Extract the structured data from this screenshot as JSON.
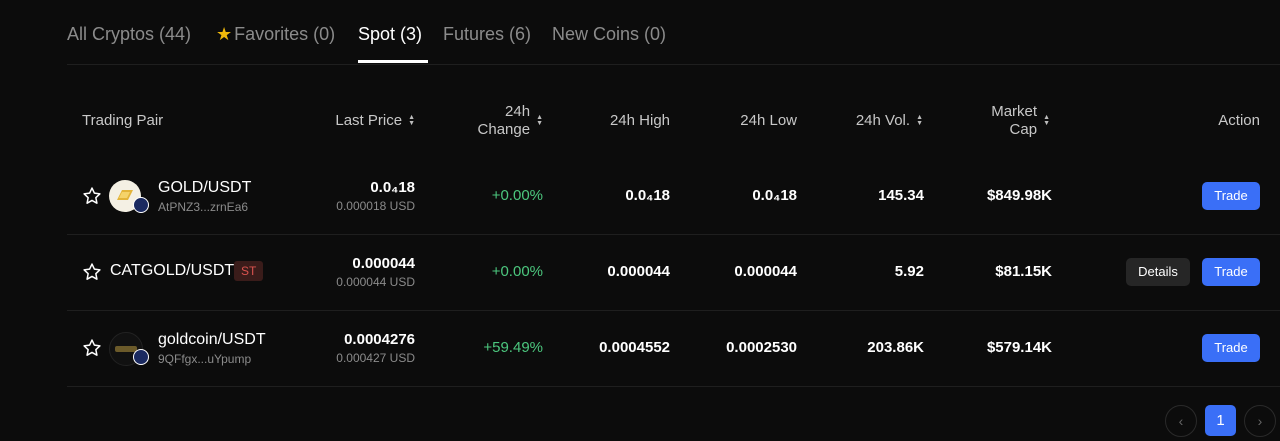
{
  "tabs": [
    {
      "label": "All Cryptos (44)"
    },
    {
      "label": "Favorites (0)"
    },
    {
      "label": "Spot (3)"
    },
    {
      "label": "Futures (6)"
    },
    {
      "label": "New Coins (0)"
    }
  ],
  "headers": {
    "pair": "Trading Pair",
    "last_price": "Last Price",
    "change_1": "24h",
    "change_2": "Change",
    "high": "24h High",
    "low": "24h Low",
    "vol": "24h Vol.",
    "cap_1": "Market",
    "cap_2": "Cap",
    "action": "Action"
  },
  "rows": [
    {
      "pair": "GOLD/USDT",
      "address": "AtPNZ3...zrnEa6",
      "price_main": "0.0₄18",
      "price_usd": "0.000018 USD",
      "change": "+0.00%",
      "high": "0.0₄18",
      "low": "0.0₄18",
      "vol": "145.34",
      "cap": "$849.98K",
      "trade": "Trade"
    },
    {
      "pair": "CATGOLD/USDT",
      "badge": "ST",
      "price_main": "0.000044",
      "price_usd": "0.000044 USD",
      "change": "+0.00%",
      "high": "0.000044",
      "low": "0.000044",
      "vol": "5.92",
      "cap": "$81.15K",
      "details": "Details",
      "trade": "Trade"
    },
    {
      "pair": "goldcoin/USDT",
      "address": "9QFfgx...uYpump",
      "price_main": "0.0004276",
      "price_usd": "0.000427 USD",
      "change": "+59.49%",
      "high": "0.0004552",
      "low": "0.0002530",
      "vol": "203.86K",
      "cap": "$579.14K",
      "trade": "Trade"
    }
  ],
  "pagination": {
    "current": "1"
  },
  "colors": {
    "accent": "#3a6ff7",
    "positive": "#4cc77e",
    "favorite": "#f0b90b"
  }
}
